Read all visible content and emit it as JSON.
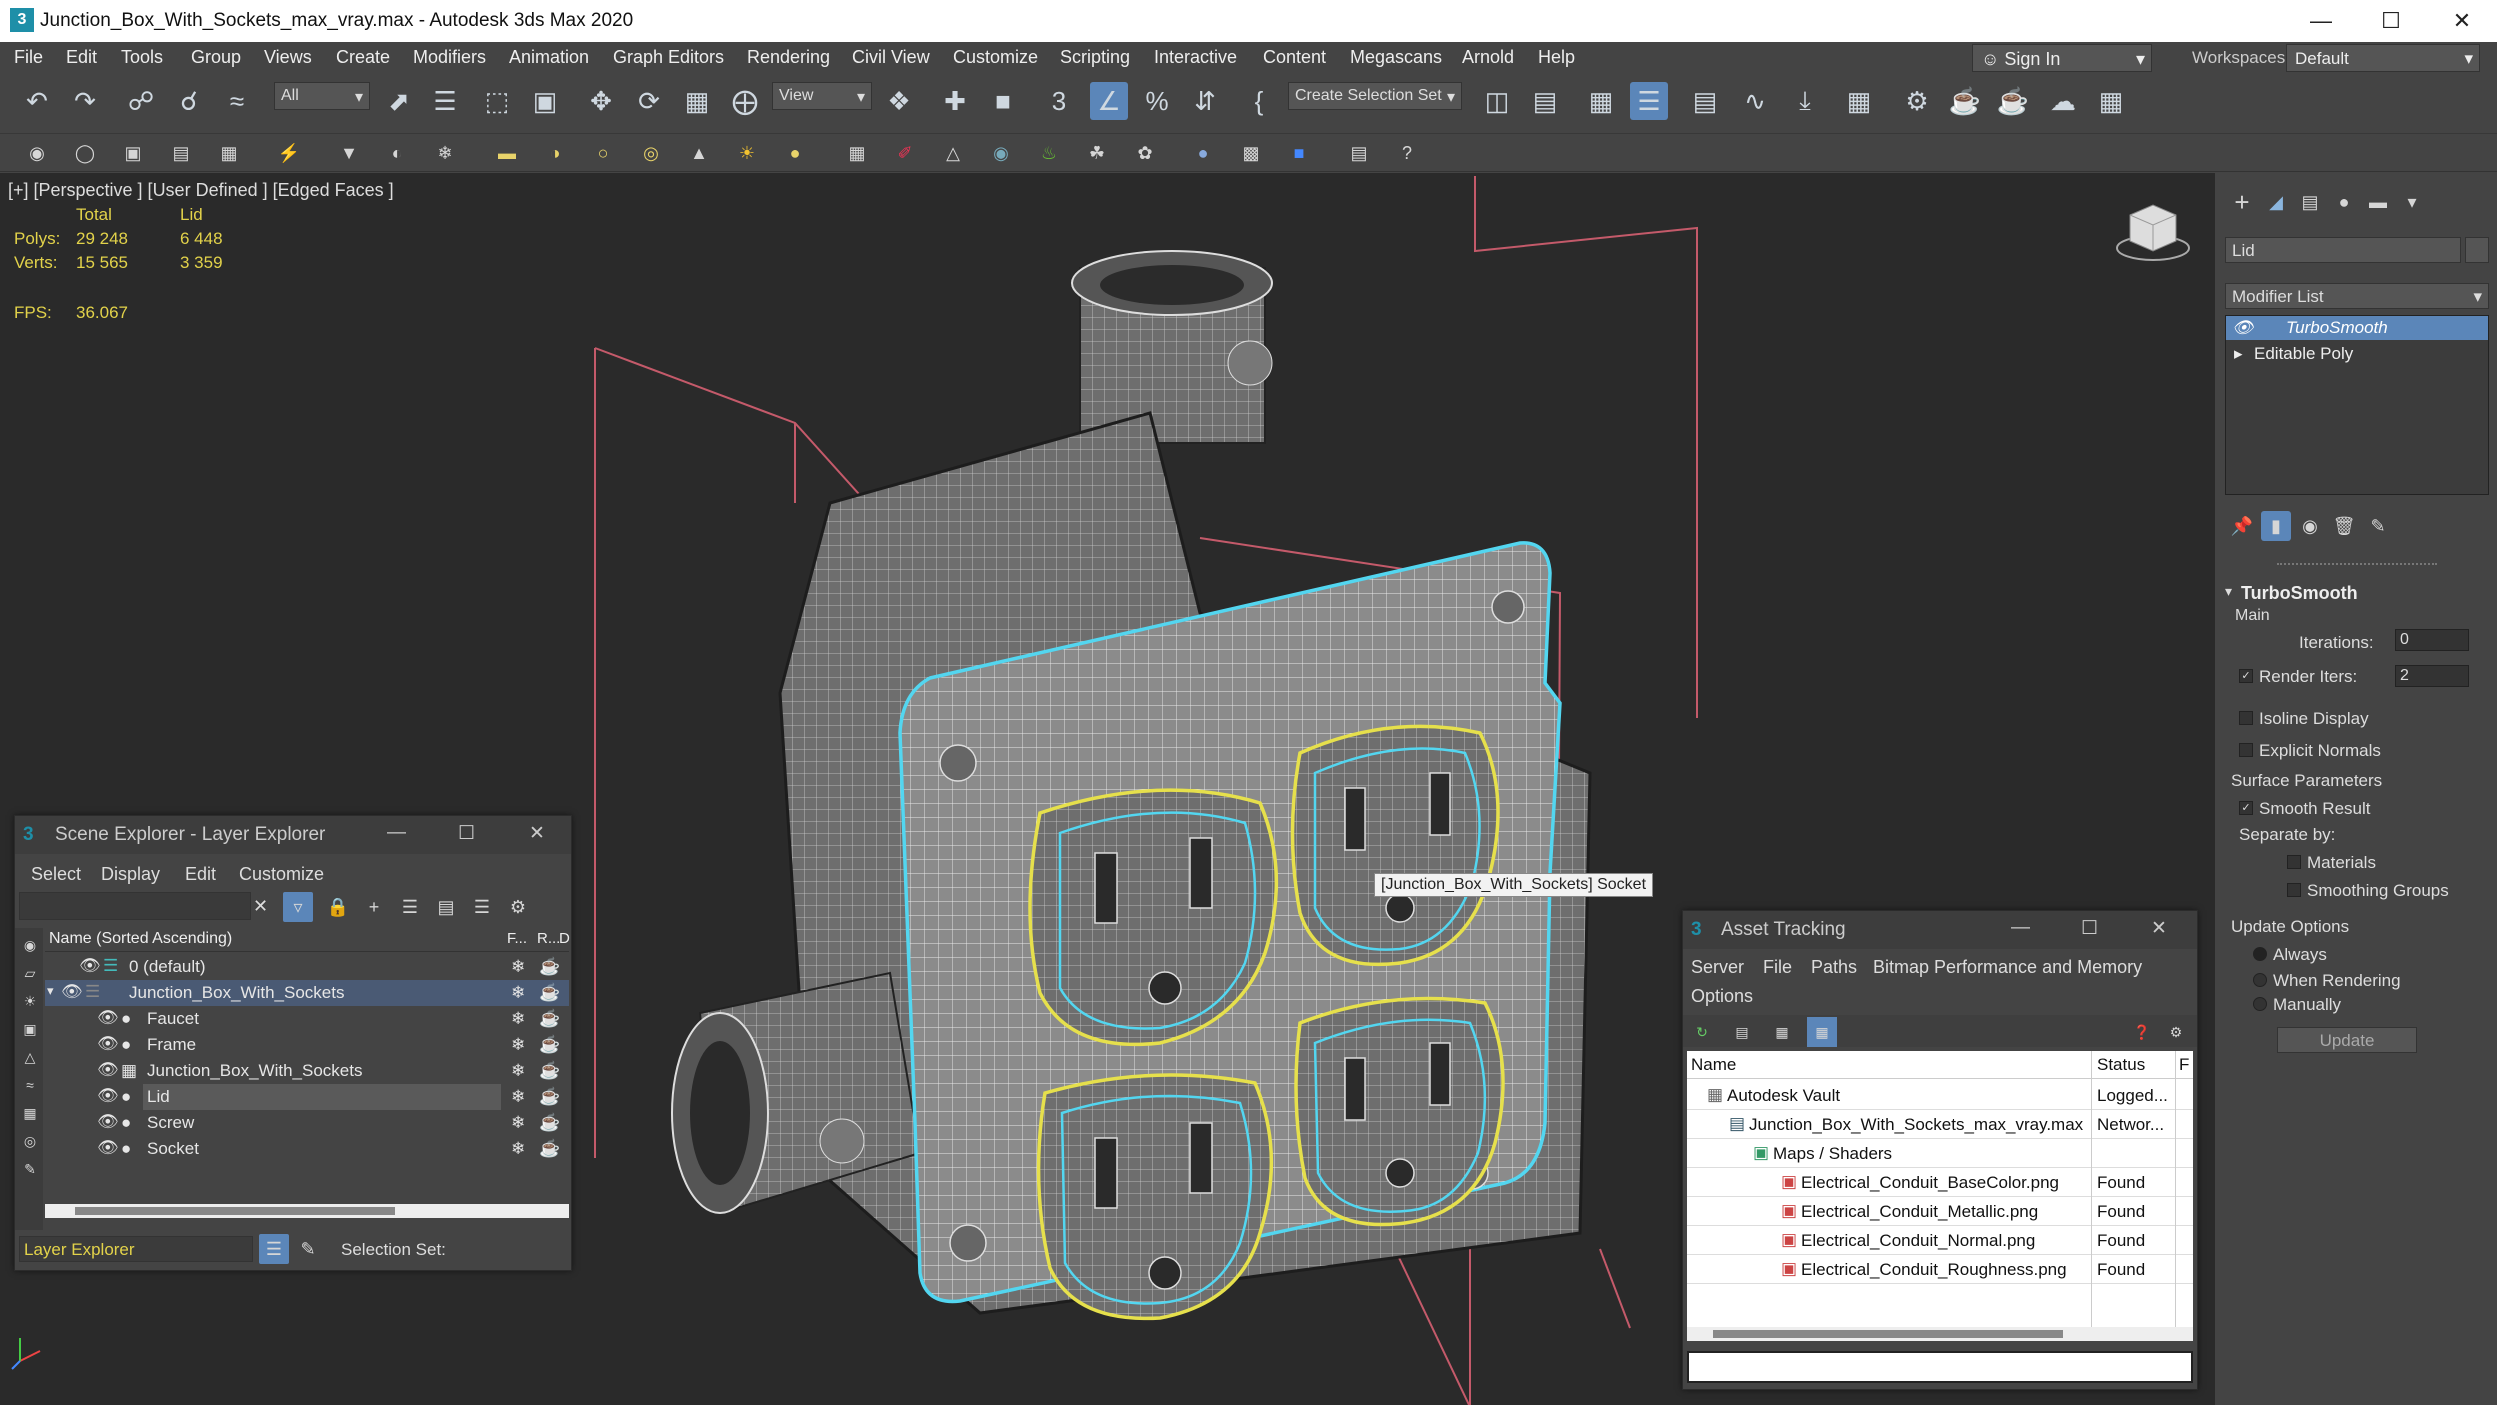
{
  "window": {
    "title": "Junction_Box_With_Sockets_max_vray.max - Autodesk 3ds Max 2020"
  },
  "menu": [
    "File",
    "Edit",
    "Tools",
    "Group",
    "Views",
    "Create",
    "Modifiers",
    "Animation",
    "Graph Editors",
    "Rendering",
    "Civil View",
    "Customize",
    "Scripting",
    "Interactive",
    "Content",
    "Megascans",
    "Arnold",
    "Help"
  ],
  "account": {
    "sign_in": "Sign In",
    "workspaces_label": "Workspaces:",
    "workspace": "Default"
  },
  "toolbar": {
    "selection_filter": "All",
    "ref_coord": "View",
    "selection_set": "Create Selection Set"
  },
  "viewport": {
    "label": "[+] [Perspective ] [User Defined ] [Edged Faces ]",
    "stats": {
      "col_total": "Total",
      "col_lid": "Lid",
      "polys_label": "Polys:",
      "polys_total": "29 248",
      "polys_lid": "6 448",
      "verts_label": "Verts:",
      "verts_total": "15 565",
      "verts_lid": "3 359",
      "fps_label": "FPS:",
      "fps": "36.067"
    },
    "tooltip": "[Junction_Box_With_Sockets] Socket"
  },
  "command_panel": {
    "object_name": "Lid",
    "modifier_list": "Modifier List",
    "stack": [
      "TurboSmooth",
      "Editable Poly"
    ],
    "rollout": "TurboSmooth",
    "main": "Main",
    "iterations_label": "Iterations:",
    "iterations": "0",
    "render_iters_label": "Render Iters:",
    "render_iters": "2",
    "isoline": "Isoline Display",
    "explicit_normals": "Explicit Normals",
    "surface_params": "Surface Parameters",
    "smooth_result": "Smooth Result",
    "separate_by": "Separate by:",
    "materials": "Materials",
    "smoothing_groups": "Smoothing Groups",
    "update_options": "Update Options",
    "always": "Always",
    "when_rendering": "When Rendering",
    "manually": "Manually",
    "update_button": "Update"
  },
  "scene_explorer": {
    "title": "Scene Explorer - Layer Explorer",
    "menu": [
      "Select",
      "Display",
      "Edit",
      "Customize"
    ],
    "col_name": "Name (Sorted Ascending)",
    "col_f": "F...",
    "col_r": "R...",
    "col_d": "D",
    "rows": [
      {
        "label": "0 (default)",
        "indent": 0
      },
      {
        "label": "Junction_Box_With_Sockets",
        "indent": 0
      },
      {
        "label": "Faucet",
        "indent": 1
      },
      {
        "label": "Frame",
        "indent": 1
      },
      {
        "label": "Junction_Box_With_Sockets",
        "indent": 1
      },
      {
        "label": "Lid",
        "indent": 1
      },
      {
        "label": "Screw",
        "indent": 1
      },
      {
        "label": "Socket",
        "indent": 1
      }
    ],
    "footer_explorer": "Layer Explorer",
    "selection_set": "Selection Set:"
  },
  "asset_tracking": {
    "title": "Asset Tracking",
    "menu": [
      "Server",
      "File",
      "Paths",
      "Bitmap Performance and Memory"
    ],
    "menu2": "Options",
    "col_name": "Name",
    "col_status": "Status",
    "col_extra": "F",
    "rows": [
      {
        "name": "Autodesk Vault",
        "status": "Logged..."
      },
      {
        "name": "Junction_Box_With_Sockets_max_vray.max",
        "status": "Networ..."
      },
      {
        "name": "Maps / Shaders",
        "status": ""
      },
      {
        "name": "Electrical_Conduit_BaseColor.png",
        "status": "Found"
      },
      {
        "name": "Electrical_Conduit_Metallic.png",
        "status": "Found"
      },
      {
        "name": "Electrical_Conduit_Normal.png",
        "status": "Found"
      },
      {
        "name": "Electrical_Conduit_Roughness.png",
        "status": "Found"
      }
    ]
  },
  "colors": {
    "accent": "#5b86b9",
    "selection": "#53d6f0",
    "socket_highlight": "#e6e04c",
    "bbox": "#c45a6a"
  }
}
